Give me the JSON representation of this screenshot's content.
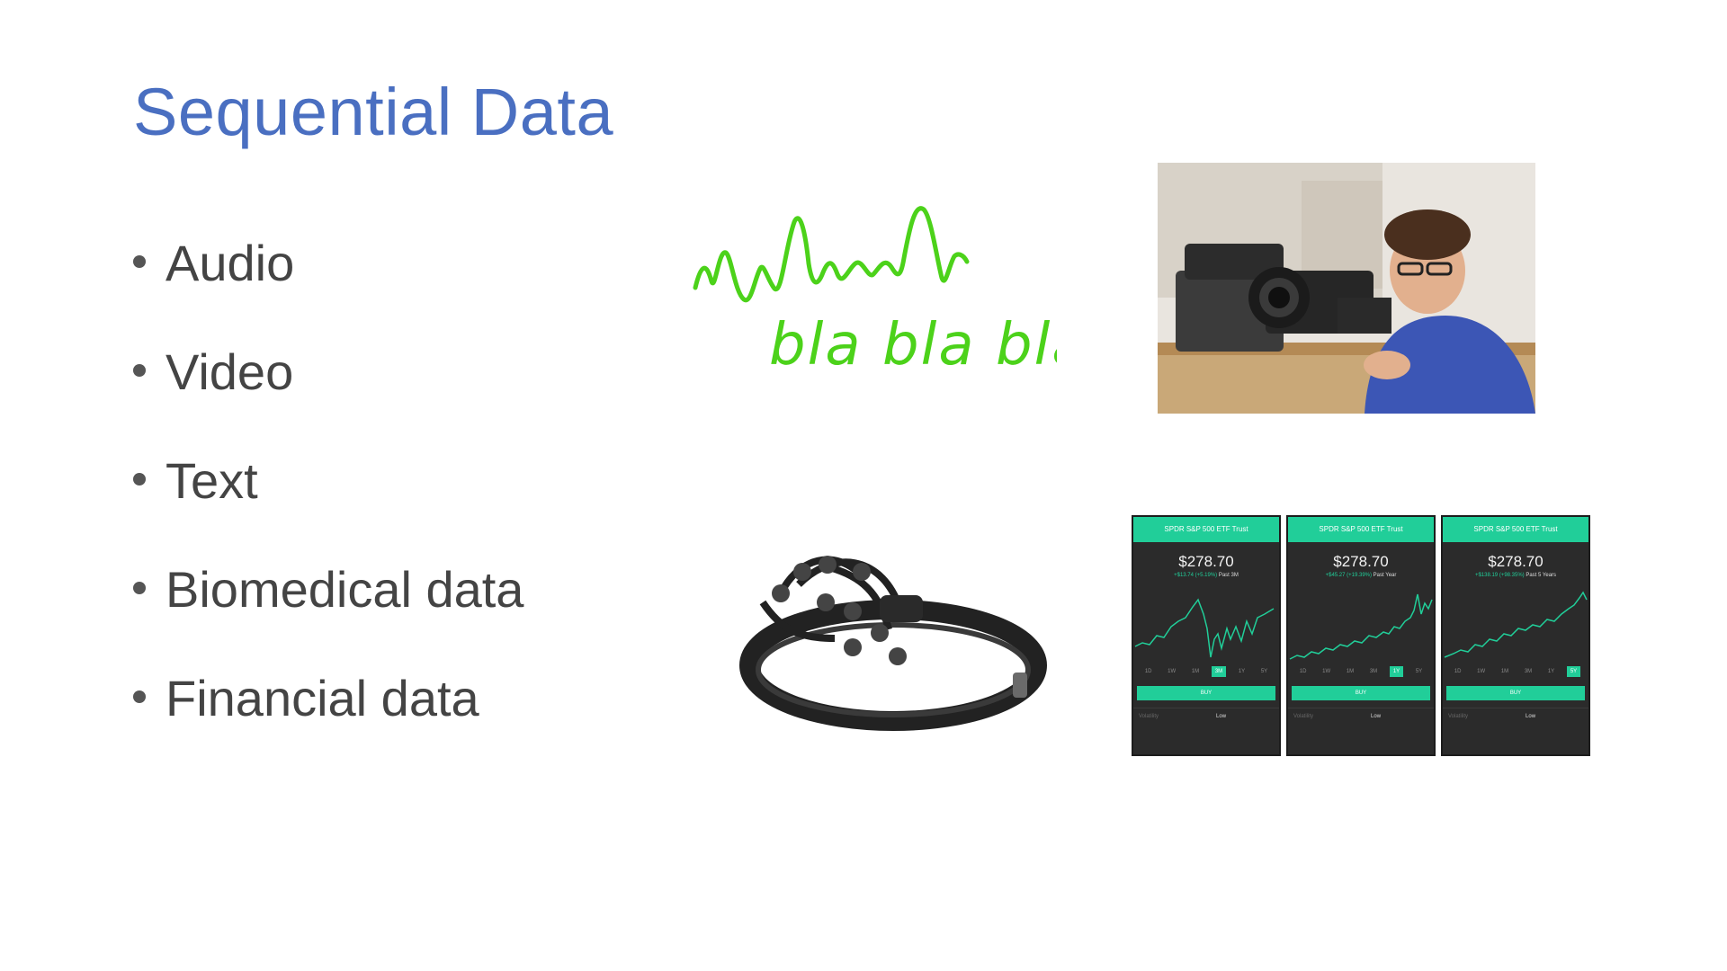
{
  "slide": {
    "title": "Sequential Data",
    "bullets": [
      "Audio",
      "Video",
      "Text",
      "Biomedical data",
      "Financial data"
    ],
    "handwriting": "bla bla bla",
    "ink_color": "#4cd21a",
    "accent_color": "#4a6fc1"
  },
  "phones": [
    {
      "header": "SPDR S&P 500 ETF Trust",
      "price": "$278.70",
      "change": "+$13.74 (+5.19%)",
      "period": "Past 3M",
      "ranges": [
        "1D",
        "1W",
        "1M",
        "3M",
        "1Y",
        "5Y"
      ],
      "selected": 3,
      "buy": "BUY",
      "row_label": "Volatility",
      "row_value": "Low"
    },
    {
      "header": "SPDR S&P 500 ETF Trust",
      "price": "$278.70",
      "change": "+$45.27 (+19.39%)",
      "period": "Past Year",
      "ranges": [
        "1D",
        "1W",
        "1M",
        "3M",
        "1Y",
        "5Y"
      ],
      "selected": 4,
      "buy": "BUY",
      "row_label": "Volatility",
      "row_value": "Low"
    },
    {
      "header": "SPDR S&P 500 ETF Trust",
      "price": "$278.70",
      "change": "+$138.19 (+98.35%)",
      "period": "Past 5 Years",
      "ranges": [
        "1D",
        "1W",
        "1M",
        "3M",
        "1Y",
        "5Y"
      ],
      "selected": 5,
      "buy": "BUY",
      "row_label": "Volatility",
      "row_value": "Low"
    }
  ]
}
